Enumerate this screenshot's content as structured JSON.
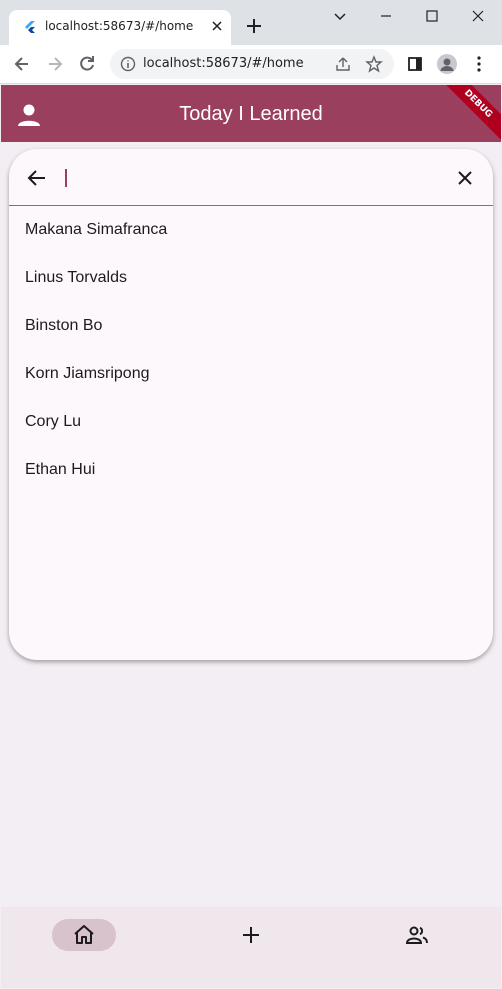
{
  "browser": {
    "tab_title": "localhost:58673/#/home",
    "url": "localhost:58673/#/home"
  },
  "app": {
    "title": "Today I Learned",
    "debug_label": "DEBUG",
    "accent_color": "#9a3f5d"
  },
  "search": {
    "query": "",
    "results": [
      "Makana Simafranca",
      "Linus Torvalds",
      "Binston Bo",
      "Korn Jiamsripong",
      "Cory Lu",
      "Ethan Hui"
    ]
  },
  "bottom_nav": {
    "selected": "home",
    "items": [
      "home-icon",
      "add-icon",
      "people-icon"
    ]
  }
}
